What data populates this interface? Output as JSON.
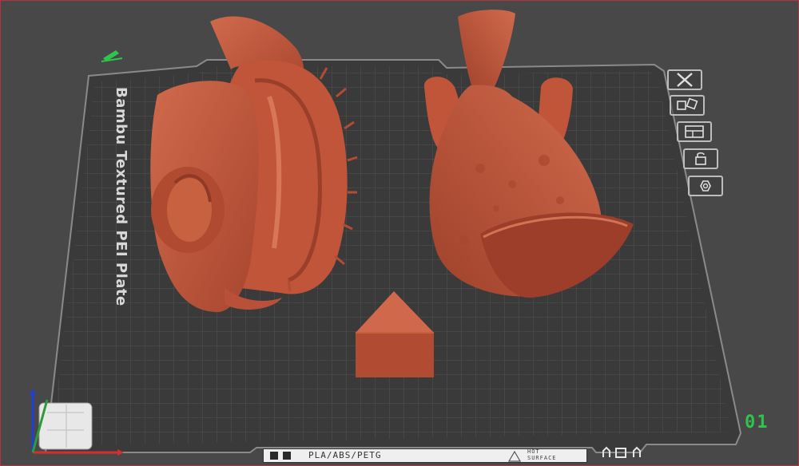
{
  "plate": {
    "name": "Bambu Textured PEI Plate",
    "number": "01",
    "material_label": "PLA/ABS/PETG",
    "warning_line1": "HOT",
    "warning_line2": "SURFACE"
  },
  "toolbar": {
    "icons": [
      "close-icon",
      "arrange-icon",
      "layout-icon",
      "lock-icon",
      "settings-icon"
    ]
  },
  "axes": {
    "x_color": "#d32f2f",
    "y_color": "#2e9b3a",
    "z_color": "#1f3fd6"
  },
  "colors": {
    "model": "#c2583d",
    "bed": "#3b3b3c",
    "grid": "#525253",
    "background": "#484848",
    "accent": "#2fc44b"
  }
}
